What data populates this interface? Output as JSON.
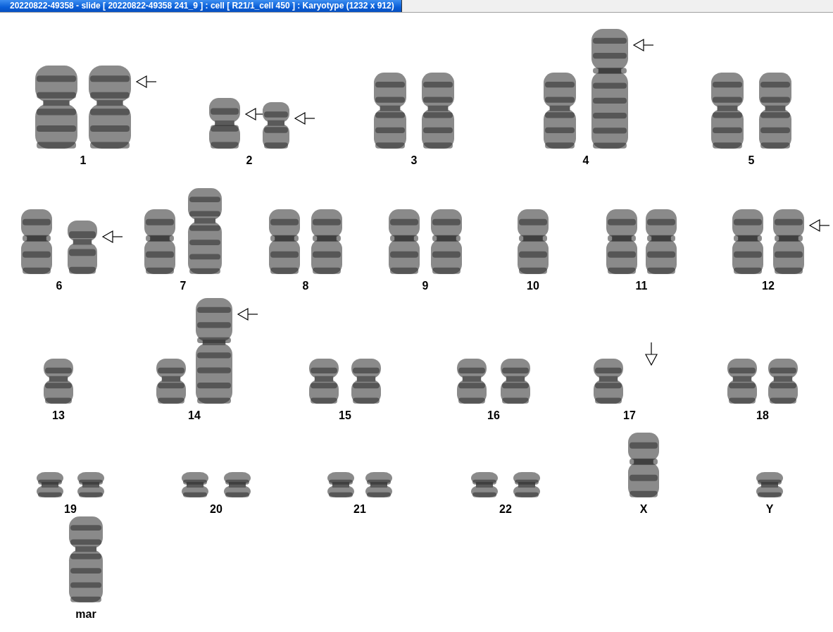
{
  "window": {
    "title": "20220822-49358 - slide [ 20220822-49358 241_9 ] : cell [ R21/1_cell 450 ] : Karyotype  (1232 x 912)"
  },
  "karyotype": {
    "rows": [
      {
        "groups": [
          {
            "label": "1",
            "chromosomes": [
              {
                "kind": "xl"
              },
              {
                "kind": "xl",
                "arrow": true
              }
            ]
          },
          {
            "label": "2",
            "chromosomes": [
              {
                "kind": "sm",
                "arrow": true
              },
              {
                "kind": "sm2",
                "arrow": true
              }
            ]
          },
          {
            "label": "3",
            "chromosomes": [
              {
                "kind": "l"
              },
              {
                "kind": "l"
              }
            ]
          },
          {
            "label": "4",
            "chromosomes": [
              {
                "kind": "l"
              },
              {
                "kind": "xxl",
                "arrow": true
              }
            ]
          },
          {
            "label": "5",
            "chromosomes": [
              {
                "kind": "l"
              },
              {
                "kind": "l"
              }
            ]
          }
        ]
      },
      {
        "groups": [
          {
            "label": "6",
            "chromosomes": [
              {
                "kind": "m"
              },
              {
                "kind": "m2",
                "arrow": true
              }
            ]
          },
          {
            "label": "7",
            "chromosomes": [
              {
                "kind": "m"
              },
              {
                "kind": "ml"
              }
            ]
          },
          {
            "label": "8",
            "chromosomes": [
              {
                "kind": "m"
              },
              {
                "kind": "m"
              }
            ]
          },
          {
            "label": "9",
            "chromosomes": [
              {
                "kind": "m"
              },
              {
                "kind": "m"
              }
            ]
          },
          {
            "label": "10",
            "chromosomes": [
              {
                "kind": "m"
              }
            ]
          },
          {
            "label": "11",
            "chromosomes": [
              {
                "kind": "m"
              },
              {
                "kind": "m"
              }
            ]
          },
          {
            "label": "12",
            "chromosomes": [
              {
                "kind": "m"
              },
              {
                "kind": "m",
                "arrow": true
              }
            ]
          }
        ]
      },
      {
        "groups": [
          {
            "label": "13",
            "chromosomes": [
              {
                "kind": "s"
              }
            ]
          },
          {
            "label": "14",
            "chromosomes": [
              {
                "kind": "s"
              },
              {
                "kind": "ml2",
                "arrow": true
              }
            ]
          },
          {
            "label": "15",
            "chromosomes": [
              {
                "kind": "s"
              },
              {
                "kind": "s"
              }
            ]
          },
          {
            "label": "16",
            "chromosomes": [
              {
                "kind": "s"
              },
              {
                "kind": "s"
              }
            ]
          },
          {
            "label": "17",
            "chromosomes": [
              {
                "kind": "s"
              },
              {
                "kind": "absent",
                "arrow": true
              }
            ]
          },
          {
            "label": "18",
            "chromosomes": [
              {
                "kind": "s"
              },
              {
                "kind": "s"
              }
            ]
          }
        ]
      },
      {
        "groups": [
          {
            "label": "19",
            "chromosomes": [
              {
                "kind": "xs"
              },
              {
                "kind": "xs"
              }
            ]
          },
          {
            "label": "20",
            "chromosomes": [
              {
                "kind": "xs"
              },
              {
                "kind": "xs"
              }
            ]
          },
          {
            "label": "21",
            "chromosomes": [
              {
                "kind": "xs"
              },
              {
                "kind": "xs"
              }
            ]
          },
          {
            "label": "22",
            "chromosomes": [
              {
                "kind": "xs"
              },
              {
                "kind": "xs"
              }
            ]
          },
          {
            "label": "X",
            "chromosomes": [
              {
                "kind": "m"
              }
            ]
          },
          {
            "label": "Y",
            "chromosomes": [
              {
                "kind": "xs"
              }
            ]
          }
        ]
      },
      {
        "groups": [
          {
            "label": "mar",
            "chromosomes": [
              {
                "kind": "ml"
              }
            ]
          }
        ]
      }
    ]
  }
}
